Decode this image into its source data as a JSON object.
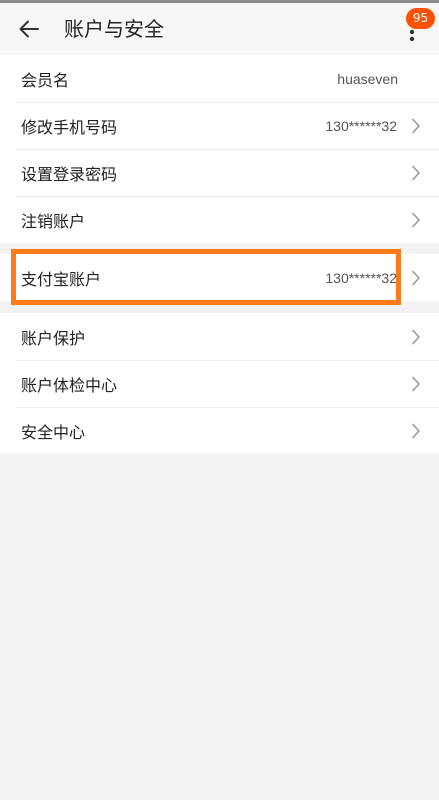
{
  "header": {
    "title": "账户与安全",
    "badge_count": "95",
    "icons": {
      "back": "back-arrow-icon",
      "more": "more-vertical-icon"
    }
  },
  "group1": [
    {
      "label": "会员名",
      "value": "huaseven",
      "chevron": false
    },
    {
      "label": "修改手机号码",
      "value": "130******32",
      "chevron": true
    },
    {
      "label": "设置登录密码",
      "value": "",
      "chevron": true
    },
    {
      "label": "注销账户",
      "value": "",
      "chevron": true
    }
  ],
  "group2": [
    {
      "label": "支付宝账户",
      "value": "130******32",
      "chevron": true
    }
  ],
  "group3": [
    {
      "label": "账户保护",
      "value": "",
      "chevron": true
    },
    {
      "label": "账户体检中心",
      "value": "",
      "chevron": true
    },
    {
      "label": "安全中心",
      "value": "",
      "chevron": true
    }
  ],
  "colors": {
    "accent": "#ff5000",
    "highlight": "#ff7a1a",
    "background": "#f2f2f2"
  }
}
